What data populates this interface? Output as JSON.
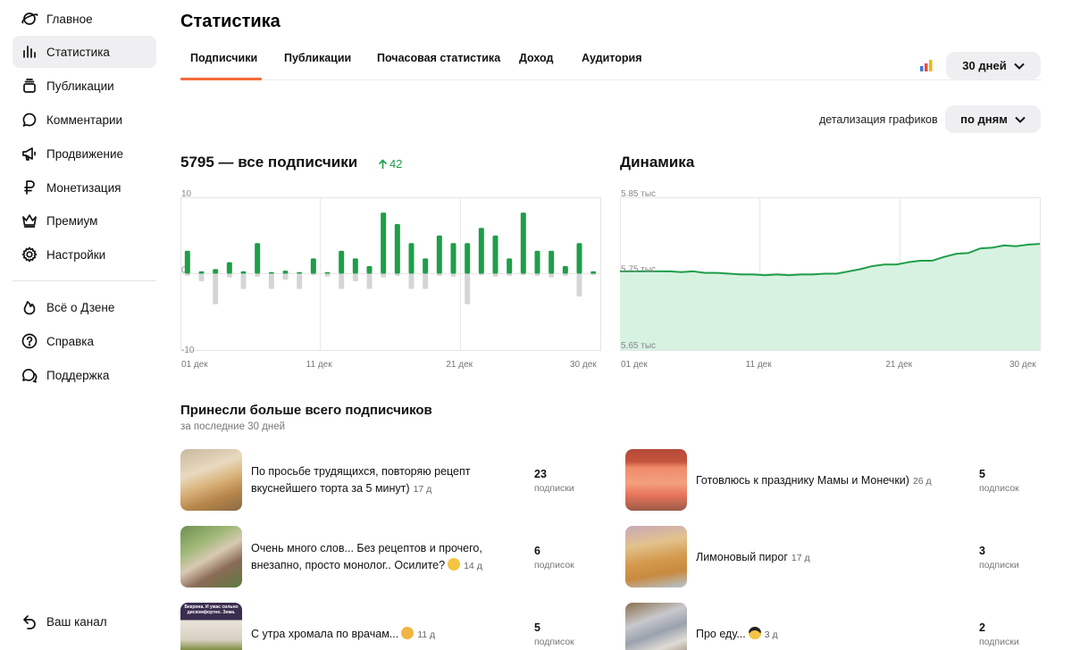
{
  "sidebar": {
    "items": [
      {
        "label": "Главное",
        "icon": "planet-icon"
      },
      {
        "label": "Статистика",
        "icon": "bar-chart-icon",
        "active": true
      },
      {
        "label": "Публикации",
        "icon": "stack-icon"
      },
      {
        "label": "Комментарии",
        "icon": "comment-icon"
      },
      {
        "label": "Продвижение",
        "icon": "megaphone-icon"
      },
      {
        "label": "Монетизация",
        "icon": "ruble-icon"
      },
      {
        "label": "Премиум",
        "icon": "crown-icon"
      },
      {
        "label": "Настройки",
        "icon": "gear-icon"
      },
      {
        "label": "Всё о Дзене",
        "icon": "flame-icon"
      },
      {
        "label": "Справка",
        "icon": "help-icon"
      },
      {
        "label": "Поддержка",
        "icon": "chat-icon"
      },
      {
        "label": "Ваш канал",
        "icon": "back-arrow-icon"
      }
    ]
  },
  "page": {
    "title": "Статистика",
    "tabs": [
      "Подписчики",
      "Публикации",
      "Почасовая статистика",
      "Доход",
      "Аудитория"
    ],
    "period": "30 дней",
    "detail_label": "детализация графиков",
    "detail_value": "по дням"
  },
  "subscribers": {
    "total_title": "5795 — все подписчики",
    "delta": "42",
    "accent": "#1f9e4a"
  },
  "dynamics": {
    "title": "Динамика"
  },
  "chart_data": [
    {
      "type": "bar",
      "title": "5795 — все подписчики",
      "ylim": [
        -10,
        10
      ],
      "y_ticks": [
        "10",
        "0",
        "-10"
      ],
      "x_ticks": [
        "01 дек",
        "11 дек",
        "21 дек",
        "30 дек"
      ],
      "series": [
        {
          "values": [
            3,
            0.3,
            0.6,
            1.5,
            0.3,
            4,
            0.2,
            0.4,
            0.2,
            2,
            0.2,
            3,
            2,
            1,
            8,
            6.5,
            4,
            2,
            5,
            4,
            4,
            6,
            5,
            2,
            8,
            3,
            3,
            1,
            4,
            0.3
          ],
          "color": "#1f9e4a"
        },
        {
          "values": [
            -0.3,
            -1,
            -4,
            -0.5,
            -2,
            -0.4,
            -2,
            -0.8,
            -2,
            -0.2,
            -0.4,
            -2,
            -1,
            -2,
            -0.5,
            -0.3,
            -2,
            -2,
            -0.3,
            -0.4,
            -4,
            -0.2,
            -0.4,
            -0.3,
            -0.2,
            -0.3,
            -0.5,
            -0.3,
            -3,
            -0.2
          ],
          "color": "#d5d5d8"
        }
      ]
    },
    {
      "type": "area",
      "title": "Динамика",
      "ylim": [
        5.65,
        5.85
      ],
      "y_ticks": [
        "5.85 тыс",
        "5.75 тыс",
        "5.65 тыс"
      ],
      "x_ticks": [
        "01 дек",
        "11 дек",
        "21 дек",
        "30 дек"
      ],
      "series": [
        {
          "values": [
            5.753,
            5.753,
            5.752,
            5.753,
            5.751,
            5.751,
            5.75,
            5.749,
            5.749,
            5.748,
            5.749,
            5.748,
            5.749,
            5.749,
            5.75,
            5.75,
            5.753,
            5.756,
            5.76,
            5.762,
            5.762,
            5.765,
            5.767,
            5.767,
            5.772,
            5.776,
            5.777,
            5.783,
            5.784,
            5.787,
            5.786,
            5.788,
            5.789
          ],
          "color": "#1f9e4a"
        }
      ]
    }
  ],
  "top": {
    "title": "Принесли больше всего подписчиков",
    "subtitle": "за последние 30 дней",
    "posts": [
      {
        "text": "По просьбе трудящихся, повторяю рецепт вкуснейшего торта за 5 минут)",
        "age": "17 д",
        "count": "23",
        "unit": "подписки",
        "col": 0,
        "row": 0
      },
      {
        "text": "Очень много слов... Без рецептов и прочего, внезапно, просто монолог.. Осилите?",
        "age": "14 д",
        "count": "6",
        "unit": "подписок",
        "col": 0,
        "row": 1,
        "emoji": "smile"
      },
      {
        "text": "С утра хромала по врачам...",
        "age": "11 д",
        "count": "5",
        "unit": "подписок",
        "col": 0,
        "row": 2,
        "emoji": "cat"
      },
      {
        "text": "Готовлюсь к празднику Мамы и Монечки)",
        "age": "26 д",
        "count": "5",
        "unit": "подписок",
        "col": 1,
        "row": 0
      },
      {
        "text": "Лимоновый пирог",
        "age": "17 д",
        "count": "3",
        "unit": "подписки",
        "col": 1,
        "row": 1
      },
      {
        "text": "Про еду...",
        "age": "3 д",
        "count": "2",
        "unit": "подписки",
        "col": 1,
        "row": 2,
        "emoji": "cool"
      }
    ],
    "thumb_text": "Бекрона. И ужас сильно дискомфортно. Зима."
  }
}
